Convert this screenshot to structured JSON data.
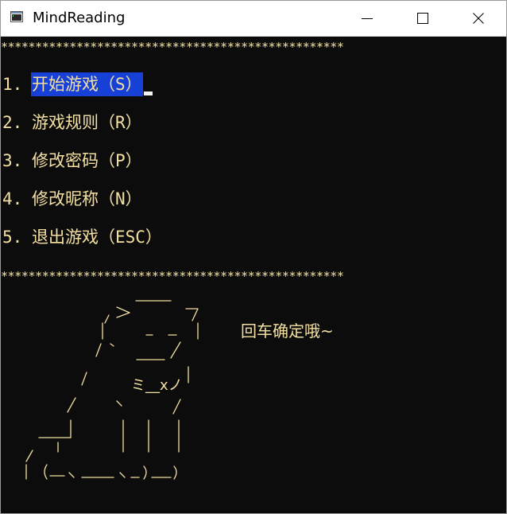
{
  "window": {
    "title": "MindReading",
    "icon": "console-app-icon",
    "controls": [
      "minimize-icon",
      "maximize-icon",
      "close-icon"
    ]
  },
  "console": {
    "separator": "**************************************************",
    "menu": [
      {
        "number": "1.",
        "label": "开始游戏（S）",
        "selected": true
      },
      {
        "number": "2.",
        "label": "游戏规则（R）",
        "selected": false
      },
      {
        "number": "3.",
        "label": "修改密码（P）",
        "selected": false
      },
      {
        "number": "4.",
        "label": "修改昵称（N）",
        "selected": false
      },
      {
        "number": "5.",
        "label": "退出游戏（ESC）",
        "selected": false
      }
    ],
    "hint": "回车确定哦~",
    "ascii_art_text": "ミ__xノ",
    "colors": {
      "background": "#0c0c0c",
      "text": "#f3e0a1",
      "selection": "#1741d6"
    }
  }
}
